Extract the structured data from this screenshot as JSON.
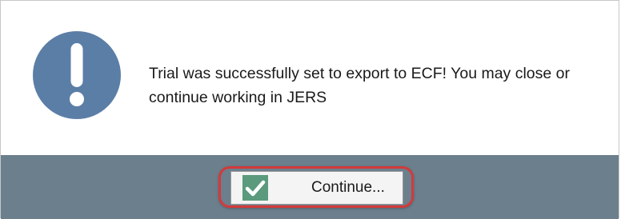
{
  "dialog": {
    "message": "Trial was successfully set to export to ECF! You may close or continue working in JERS",
    "message_icon": "exclamation-icon"
  },
  "footer": {
    "continue_label": "Continue...",
    "continue_icon": "checkmark-icon"
  },
  "colors": {
    "icon_circle": "#5b7ea6",
    "footer_bg": "#6c7f8d",
    "check_bg": "#5b9a7c",
    "highlight_ring": "#d33a3a"
  }
}
